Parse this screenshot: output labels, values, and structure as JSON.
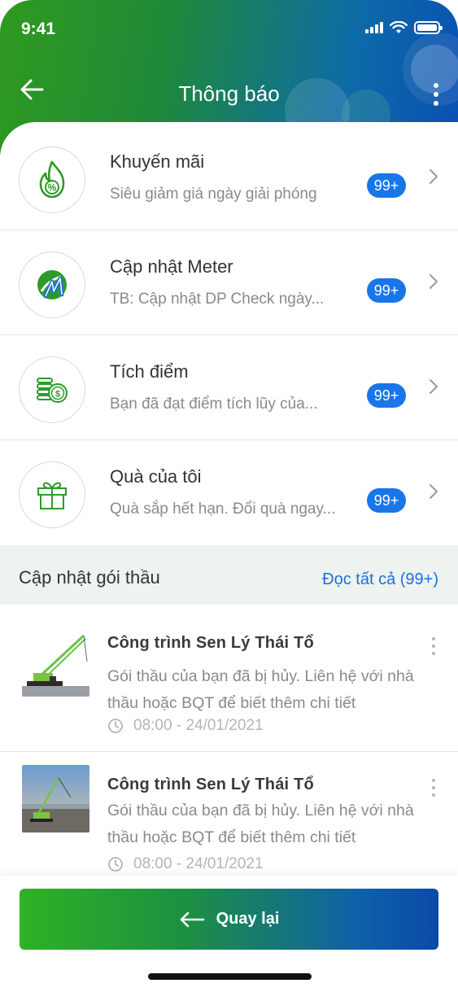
{
  "status_bar": {
    "time": "9:41"
  },
  "header": {
    "title": "Thông báo"
  },
  "notifications": [
    {
      "title": "Khuyến mãi",
      "subtitle": "Siêu giảm giá ngày giải phóng",
      "badge": "99+",
      "icon": "fire-percent-icon"
    },
    {
      "title": "Cập nhật Meter",
      "subtitle": "TB: Cập nhật DP Check ngày...",
      "badge": "99+",
      "icon": "meter-logo-icon"
    },
    {
      "title": "Tích điểm",
      "subtitle": "Bạn đã đạt điểm tích lũy của...",
      "badge": "99+",
      "icon": "coins-icon"
    },
    {
      "title": "Quà của tôi",
      "subtitle": "Quà sắp hết hạn. Đổi quà ngay...",
      "badge": "99+",
      "icon": "gift-icon"
    }
  ],
  "bid_section": {
    "title": "Cập nhật gói thầu",
    "read_all": "Đọc tất cả (99+)",
    "items": [
      {
        "title": "Công trình Sen Lý Thái Tổ",
        "body": "Gói thầu của bạn đã bị hủy. Liên hệ với nhà thầu hoặc BQT để biết thêm chi tiết",
        "time": "08:00 - 24/01/2021"
      },
      {
        "title": "Công trình Sen Lý Thái Tổ",
        "body": "Gói thầu của bạn đã bị hủy. Liên hệ với nhà thầu hoặc BQT để biết thêm chi tiết",
        "time": "08:00 - 24/01/2021"
      }
    ]
  },
  "bottom": {
    "back_label": "Quay lại"
  },
  "colors": {
    "green": "#2f9a1e",
    "blue": "#0a4fb3",
    "badge": "#1976e8",
    "link": "#1a6fd8"
  }
}
